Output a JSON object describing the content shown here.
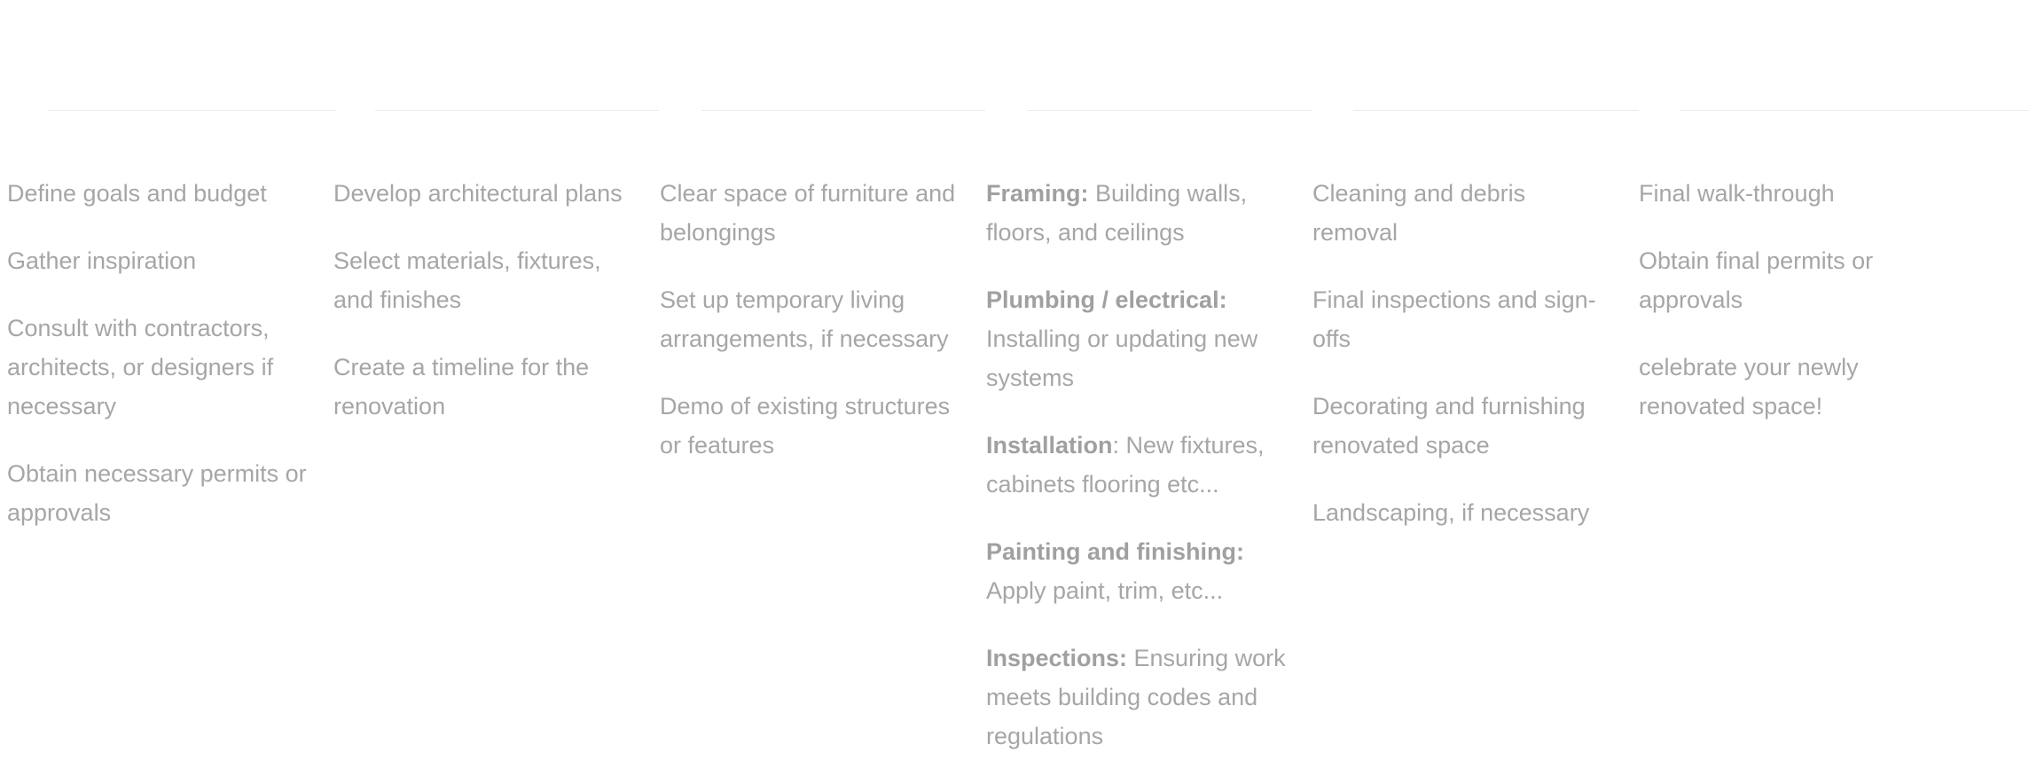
{
  "columns": [
    {
      "items": [
        {
          "bold": "",
          "text": "Define goals and budget"
        },
        {
          "bold": "",
          "text": "Gather inspiration"
        },
        {
          "bold": "",
          "text": "Consult with contractors, architects, or designers if necessary"
        },
        {
          "bold": "",
          "text": "Obtain necessary permits or approvals"
        }
      ]
    },
    {
      "items": [
        {
          "bold": "",
          "text": "Develop architectural plans"
        },
        {
          "bold": "",
          "text": "Select materials, fixtures, and finishes"
        },
        {
          "bold": "",
          "text": "Create a timeline for the renovation"
        }
      ]
    },
    {
      "items": [
        {
          "bold": "",
          "text": "Clear space of furniture and belongings"
        },
        {
          "bold": "",
          "text": "Set up temporary living arrangements, if necessary"
        },
        {
          "bold": "",
          "text": "Demo of existing structures or features"
        }
      ]
    },
    {
      "items": [
        {
          "bold": "Framing:",
          "text": " Building walls, floors, and ceilings"
        },
        {
          "bold": "Plumbing / electrical:",
          "text": " Installing or updating new systems"
        },
        {
          "bold": "Installation",
          "text": ": New fixtures, cabinets flooring etc..."
        },
        {
          "bold": "Painting and finishing:",
          "text": " Apply paint, trim, etc..."
        },
        {
          "bold": "Inspections:",
          "text": " Ensuring work meets building codes and regulations"
        }
      ]
    },
    {
      "items": [
        {
          "bold": "",
          "text": "Cleaning and debris removal"
        },
        {
          "bold": "",
          "text": "Final inspections and sign-offs"
        },
        {
          "bold": "",
          "text": "Decorating and furnishing renovated space"
        },
        {
          "bold": "",
          "text": "Landscaping, if necessary"
        }
      ]
    },
    {
      "items": [
        {
          "bold": "",
          "text": "Final walk-through"
        },
        {
          "bold": "",
          "text": "Obtain final permits or approvals"
        },
        {
          "bold": "",
          "text": "celebrate your newly renovated space!"
        }
      ]
    }
  ],
  "colors": {
    "text": "#a6a6a6",
    "divider": "#ececec",
    "background": "#ffffff"
  }
}
